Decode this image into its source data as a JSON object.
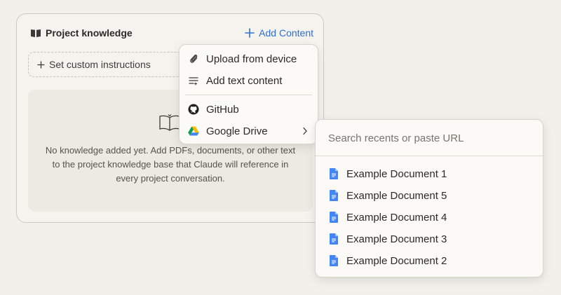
{
  "panel": {
    "title": "Project knowledge",
    "add_content_label": "Add Content",
    "custom_instructions_label": "Set custom instructions",
    "empty_text": "No knowledge added yet. Add PDFs, documents, or other text to the project knowledge base that Claude will reference in every project conversation.",
    "icons": {
      "title": "book-icon",
      "add": "plus-icon",
      "custom": "plus-icon",
      "empty": "open-book-icon"
    }
  },
  "menu": {
    "upload_label": "Upload from device",
    "text_label": "Add text content",
    "github_label": "GitHub",
    "drive_label": "Google Drive",
    "icons": [
      "paperclip-icon",
      "text-lines-icon",
      "github-icon",
      "google-drive-icon",
      "chevron-right-icon"
    ]
  },
  "drive": {
    "search_placeholder": "Search recents or paste URL",
    "documents": [
      "Example Document 1",
      "Example Document 5",
      "Example Document 4",
      "Example Document 3",
      "Example Document 2"
    ],
    "doc_icon": "google-doc-icon"
  },
  "colors": {
    "accent": "#2f6fd6",
    "doc_blue": "#4285f4",
    "background": "#f1f0ea"
  }
}
